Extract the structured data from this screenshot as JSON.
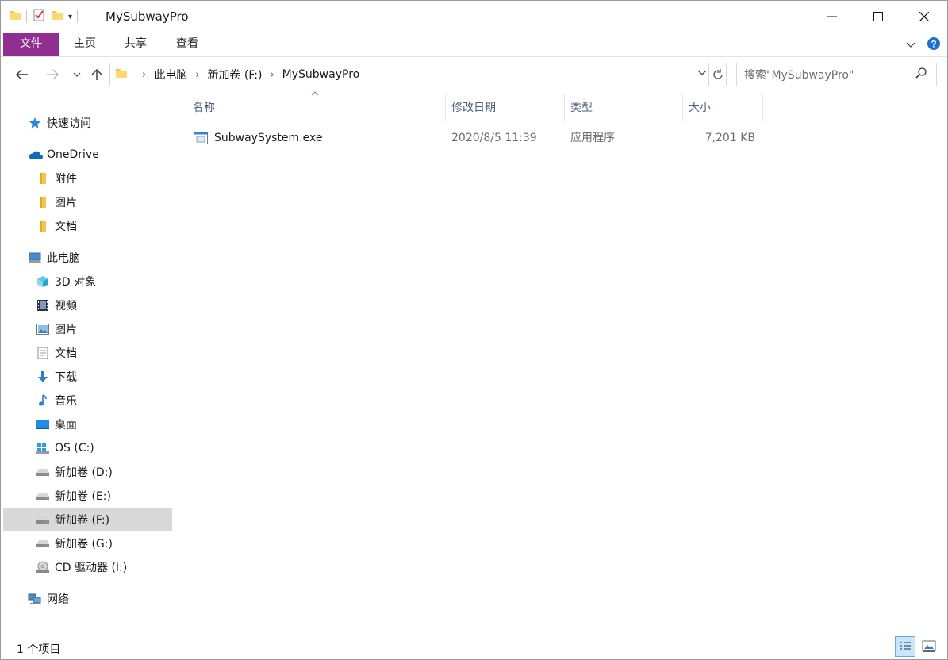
{
  "window": {
    "title": "MySubwayPro"
  },
  "ribbon": {
    "file": "文件",
    "home": "主页",
    "share": "共享",
    "view": "查看"
  },
  "address": {
    "crumbs": [
      "此电脑",
      "新加卷 (F:)",
      "MySubwayPro"
    ]
  },
  "search": {
    "placeholder": "搜索\"MySubwayPro\""
  },
  "nav": {
    "quick_access": "快速访问",
    "onedrive": "OneDrive",
    "onedrive_items": [
      "附件",
      "图片",
      "文档"
    ],
    "this_pc": "此电脑",
    "pc_items": [
      "3D 对象",
      "视频",
      "图片",
      "文档",
      "下载",
      "音乐",
      "桌面",
      "OS (C:)",
      "新加卷 (D:)",
      "新加卷 (E:)",
      "新加卷 (F:)",
      "新加卷 (G:)",
      "CD 驱动器 (I:)"
    ],
    "network": "网络",
    "selected": "新加卷 (F:)"
  },
  "columns": {
    "name": "名称",
    "modified": "修改日期",
    "type": "类型",
    "size": "大小"
  },
  "files": [
    {
      "name": "SubwaySystem.exe",
      "modified": "2020/8/5 11:39",
      "type": "应用程序",
      "size": "7,201 KB"
    }
  ],
  "status": {
    "count": "1 个项目"
  },
  "colors": {
    "file_tab": "#902e91",
    "selection": "#d9d9d9",
    "header_text": "#4c607a"
  }
}
